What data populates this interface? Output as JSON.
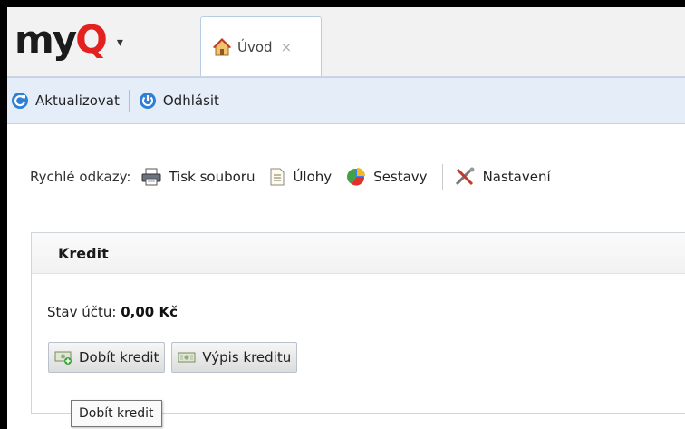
{
  "logo": {
    "text_main": "my",
    "text_accent": "Q",
    "accent_color": "#e32220",
    "caret": "▾"
  },
  "tabs": [
    {
      "label": "Úvod",
      "icon": "home-icon",
      "close": "×"
    }
  ],
  "toolbar": {
    "refresh_label": "Aktualizovat",
    "logout_label": "Odhlásit"
  },
  "quick_links": {
    "label": "Rychlé odkazy:",
    "items": [
      {
        "label": "Tisk souboru",
        "icon": "printer-icon"
      },
      {
        "label": "Úlohy",
        "icon": "document-icon"
      },
      {
        "label": "Sestavy",
        "icon": "pie-chart-icon"
      },
      {
        "label": "Nastavení",
        "icon": "tools-icon"
      }
    ]
  },
  "credit_panel": {
    "title": "Kredit",
    "balance_label": "Stav účtu:",
    "balance_value": "0,00 Kč",
    "recharge_label": "Dobít kredit",
    "statement_label": "Výpis kreditu"
  },
  "tooltip": {
    "text": "Dobít kredit"
  }
}
